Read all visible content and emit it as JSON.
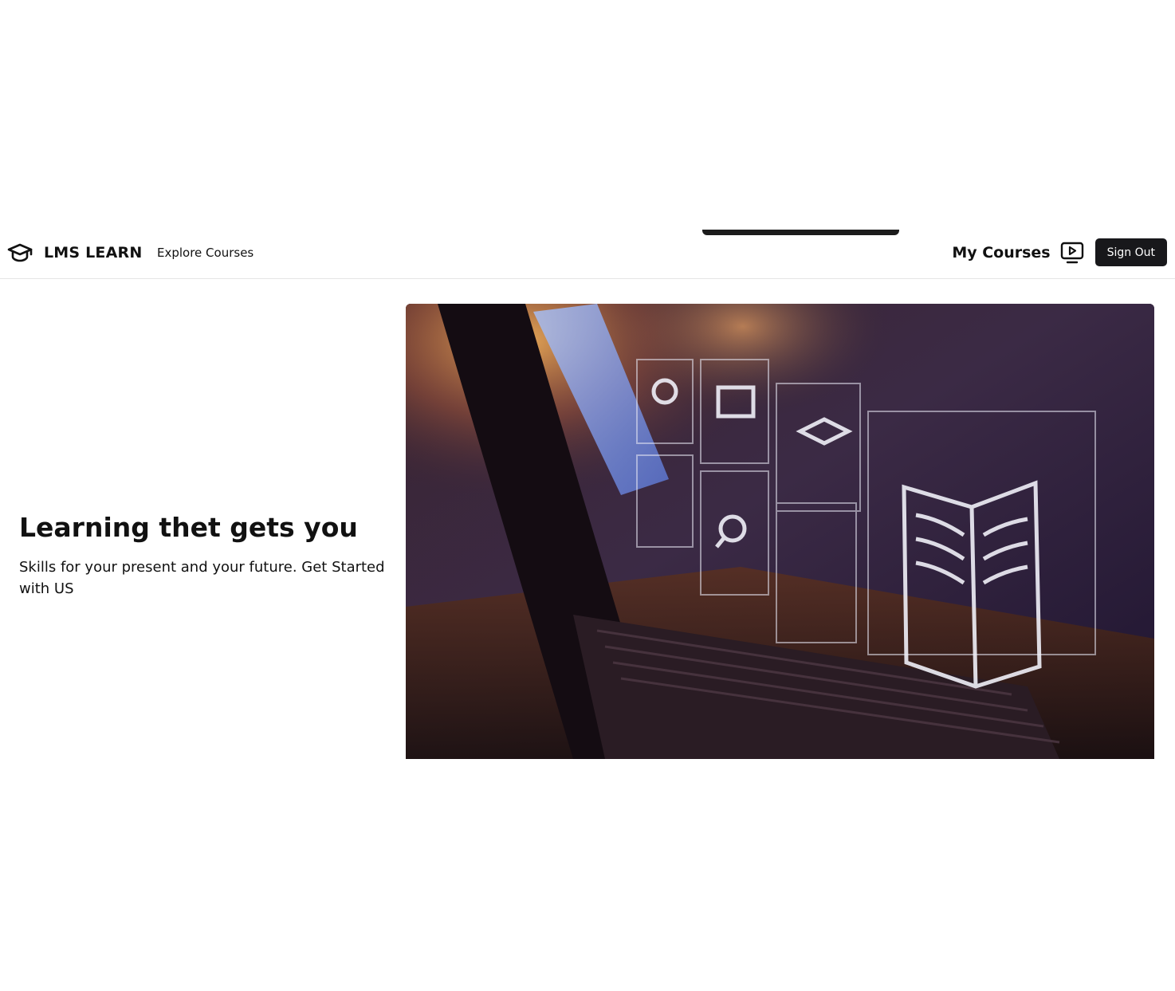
{
  "header": {
    "brand_name": "LMS LEARN",
    "brand_icon": "graduation-cap-icon",
    "explore_label": "Explore Courses",
    "my_courses_label": "My Courses",
    "my_courses_icon": "tv-play-icon",
    "signout_label": "Sign Out"
  },
  "hero": {
    "title": "Learning thet gets you",
    "subtitle": "Skills for your present and your future. Get Started with US",
    "image_alt": "laptop-with-learning-icons"
  },
  "colors": {
    "button_bg": "#18181b",
    "button_text": "#ffffff",
    "text": "#111111",
    "border": "#e5e5e5"
  }
}
